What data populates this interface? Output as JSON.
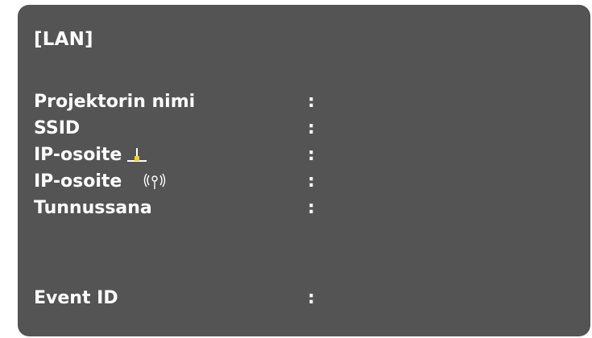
{
  "screen": {
    "title": "[LAN]",
    "fields": {
      "projector_name": {
        "label": "Projektorin nimi",
        "separator": ":"
      },
      "ssid": {
        "label": "SSID",
        "separator": ":"
      },
      "ip_wired": {
        "label": "IP-osoite",
        "icon": "wired-lan-icon",
        "separator": ":"
      },
      "ip_wireless": {
        "label": "IP-osoite",
        "icon": "wireless-lan-icon",
        "separator": ":"
      },
      "password": {
        "label": "Tunnussana",
        "separator": ":"
      },
      "event_id": {
        "label": "Event ID",
        "separator": ":"
      }
    }
  },
  "colors": {
    "panel_background": "#545454",
    "text": "#ffffff",
    "icon_accent": "#f2d21b"
  }
}
